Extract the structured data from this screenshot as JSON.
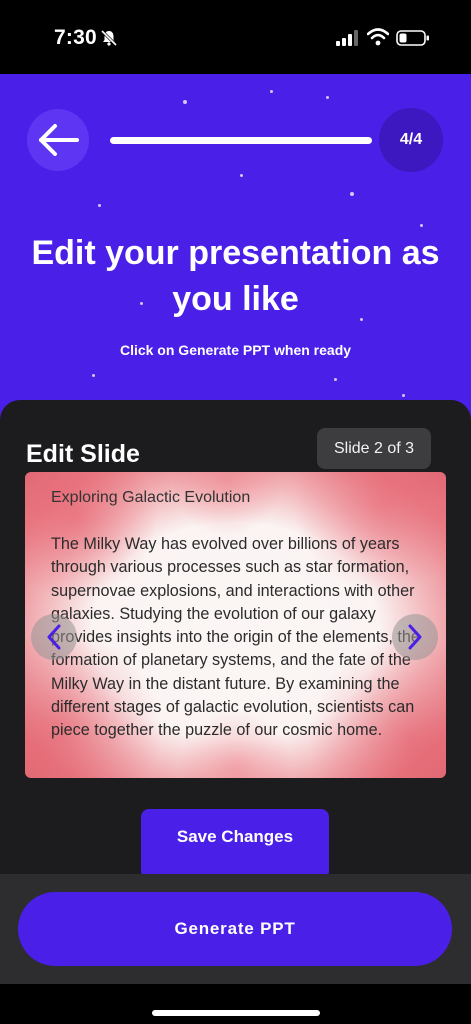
{
  "status_bar": {
    "time": "7:30",
    "icons": [
      "bell-slash-icon",
      "signal-icon",
      "wifi-icon",
      "battery-icon"
    ]
  },
  "header": {
    "back_icon": "arrow-left-icon",
    "step": "4/4",
    "progress": 1.0,
    "title": "Edit your presentation as you like",
    "subtitle": "Click on Generate PPT when ready"
  },
  "editor": {
    "title": "Edit Slide",
    "slide_counter": "Slide 2 of 3",
    "slide": {
      "heading": "Exploring Galactic Evolution",
      "body": "The Milky Way has evolved over billions of years through various processes such as star formation, supernovae explosions, and interactions with other galaxies. Studying the evolution of our galaxy provides insights into the origin of the elements, the formation of planetary systems, and the fate of the Milky Way in the distant future. By examining the different stages of galactic evolution, scientists can piece together the puzzle of our cosmic home."
    },
    "prev_icon": "chevron-left-icon",
    "next_icon": "chevron-right-icon",
    "save_label": "Save Changes"
  },
  "footer": {
    "generate_label": "Generate PPT"
  },
  "colors": {
    "accent": "#4a1fe8",
    "panel": "#1c1c1e",
    "bottom_bar": "#2d2d30"
  }
}
